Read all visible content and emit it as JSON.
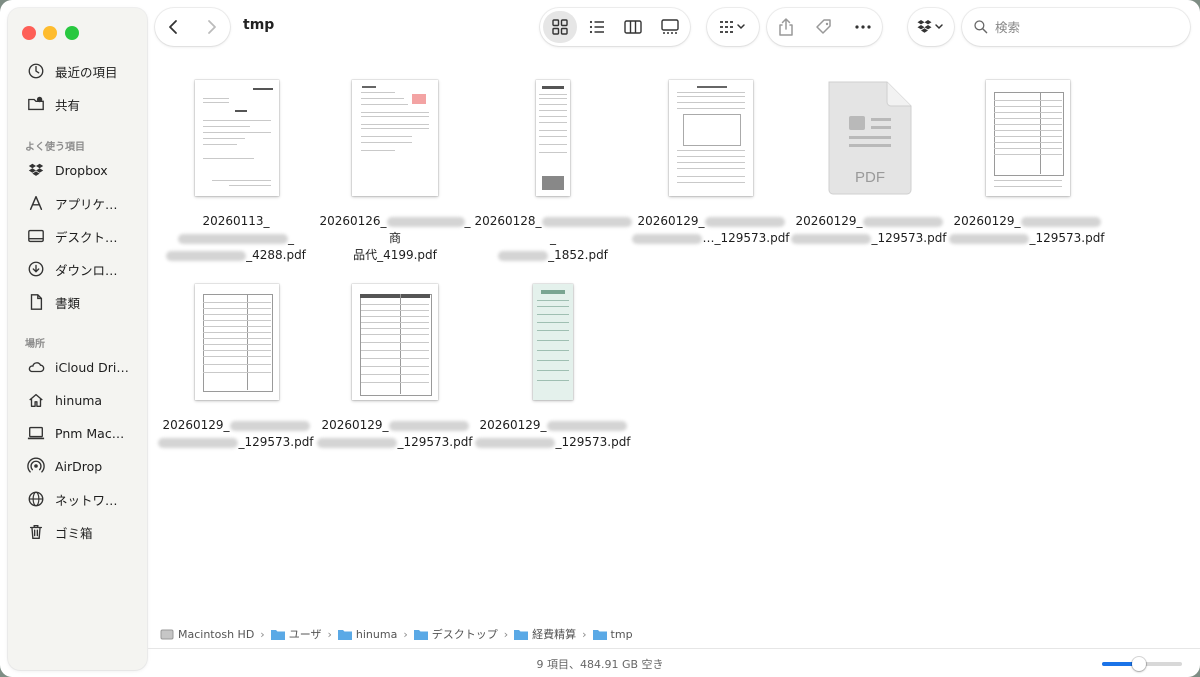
{
  "window": {
    "title": "tmp"
  },
  "sidebar": {
    "sections": [
      {
        "label": ""
      },
      {
        "label": "よく使う項目"
      },
      {
        "label": "場所"
      }
    ],
    "items": [
      {
        "label": "最近の項目",
        "icon": "clock-icon"
      },
      {
        "label": "共有",
        "icon": "shared-folder-icon"
      },
      {
        "label": "Dropbox",
        "icon": "dropbox-icon"
      },
      {
        "label": "アプリケ…",
        "icon": "applications-icon"
      },
      {
        "label": "デスクト…",
        "icon": "desktop-icon"
      },
      {
        "label": "ダウンロ…",
        "icon": "download-icon"
      },
      {
        "label": "書類",
        "icon": "document-icon"
      },
      {
        "label": "iCloud Dri…",
        "icon": "icloud-icon"
      },
      {
        "label": "hinuma",
        "icon": "home-icon"
      },
      {
        "label": "Pnm Mac…",
        "icon": "laptop-icon"
      },
      {
        "label": "AirDrop",
        "icon": "airdrop-icon"
      },
      {
        "label": "ネットワ…",
        "icon": "network-icon"
      },
      {
        "label": "ゴミ箱",
        "icon": "trash-icon"
      }
    ]
  },
  "toolbar": {
    "back_icon": "chevron-left-icon",
    "forward_icon": "chevron-right-icon",
    "view_modes": [
      "icon-view-icon",
      "list-view-icon",
      "column-view-icon",
      "gallery-view-icon"
    ],
    "active_view": "icon-view-icon",
    "search_placeholder": "検索"
  },
  "files": [
    {
      "line1_prefix": "20260113_",
      "line2_suffix": "_4288.pdf",
      "thumb": "invoice"
    },
    {
      "line1_prefix": "20260126_",
      "line1_suffix": "_商",
      "line2_suffix": "品代_4199.pdf",
      "thumb": "invoice-red"
    },
    {
      "line1_prefix": "20260128_",
      "line1_suffix": "_",
      "line2_suffix": "_1852.pdf",
      "thumb": "receipt"
    },
    {
      "line1_prefix": "20260129_",
      "line2_suffix": "…_129573.pdf",
      "thumb": "form"
    },
    {
      "line1_prefix": "20260129_",
      "line2_suffix": "_129573.pdf",
      "thumb": "pdf-generic",
      "pdf_label": "PDF"
    },
    {
      "line1_prefix": "20260129_",
      "line2_suffix": "_129573.pdf",
      "thumb": "table"
    },
    {
      "line1_prefix": "20260129_",
      "line2_suffix": "_129573.pdf",
      "thumb": "table"
    },
    {
      "line1_prefix": "20260129_",
      "line2_suffix": "_129573.pdf",
      "thumb": "table"
    },
    {
      "line1_prefix": "20260129_",
      "line2_suffix": "_129573.pdf",
      "thumb": "receipt-green"
    }
  ],
  "pathbar": [
    "Macintosh HD",
    "ユーザ",
    "hinuma",
    "デスクトップ",
    "経費精算",
    "tmp"
  ],
  "status": {
    "text": "9 項目、484.91 GB 空き"
  },
  "colors": {
    "accent": "#1a73e8",
    "folder": "#5aa9e6"
  }
}
